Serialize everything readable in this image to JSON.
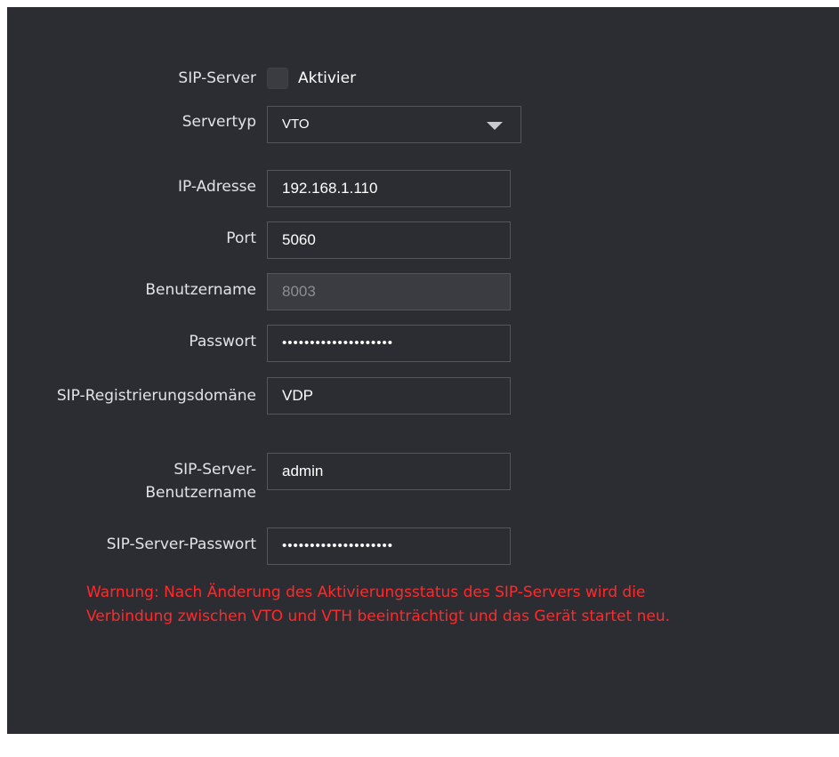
{
  "form": {
    "sip_server": {
      "label": "SIP-Server",
      "checkbox_label": "Aktivier",
      "checked": false
    },
    "server_type": {
      "label": "Servertyp",
      "value": "VTO"
    },
    "ip_address": {
      "label": "IP-Adresse",
      "value": "192.168.1.110"
    },
    "port": {
      "label": "Port",
      "value": "5060"
    },
    "username": {
      "label": "Benutzername",
      "value": "8003"
    },
    "password": {
      "label": "Passwort",
      "value": "••••••••••••••••••••"
    },
    "registration_domain": {
      "label": "SIP-Registrierungsdomäne",
      "value": "VDP"
    },
    "server_username": {
      "label": "SIP-Server-Benutzername",
      "value": "admin"
    },
    "server_password": {
      "label": "SIP-Server-Passwort",
      "value": "••••••••••••••••••••"
    }
  },
  "warning": "Warnung: Nach Änderung des Aktivierungsstatus des SIP-Servers wird die Verbindung zwischen VTO und VTH beeinträchtigt und das Gerät startet neu.",
  "colors": {
    "background": "#2b2d33",
    "field_border": "#54565c",
    "warning": "#ff2a2a",
    "label": "#e3e3e6"
  }
}
